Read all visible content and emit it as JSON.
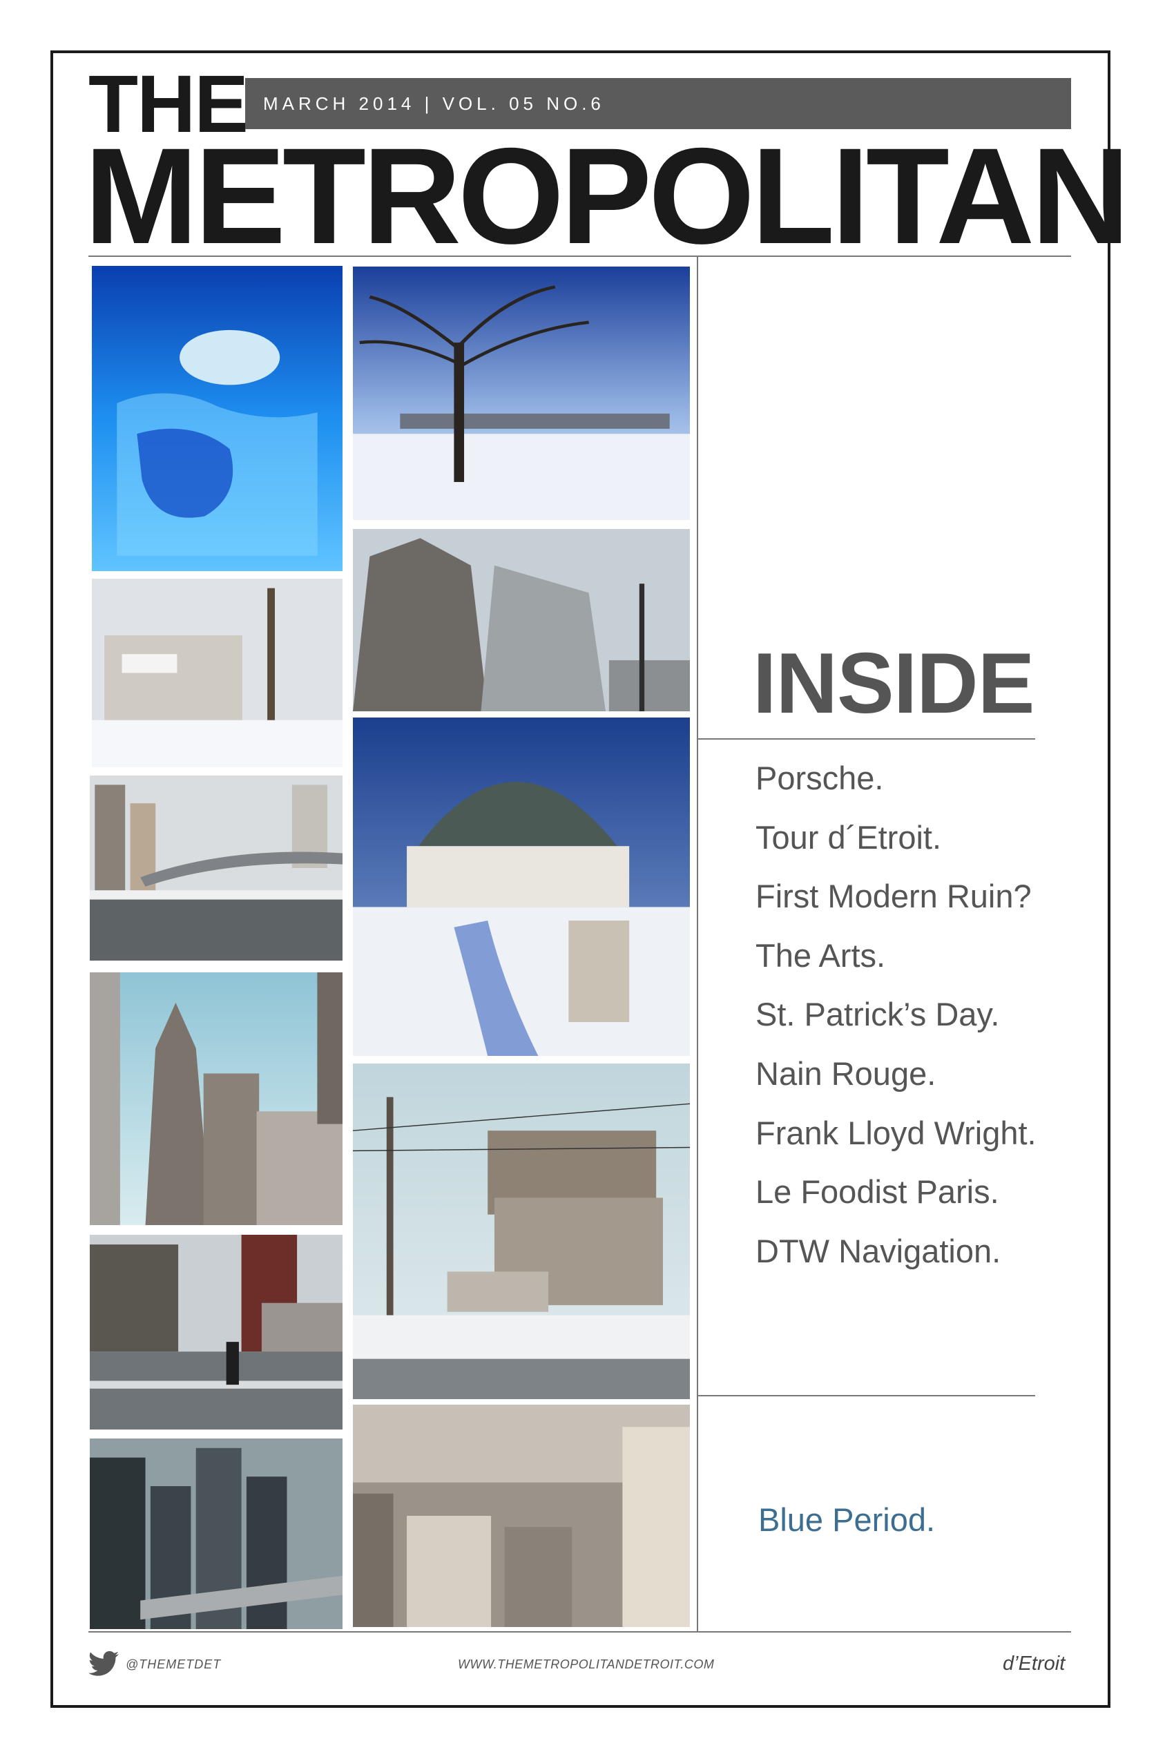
{
  "masthead": {
    "title_small": "THE",
    "title_large": "METROPOLITAN",
    "issue": "MARCH 2014 | VOL. 05 NO.6"
  },
  "photos": [
    {
      "name": "photo-polar-bear-underwater"
    },
    {
      "name": "photo-winter-tree-skyline"
    },
    {
      "name": "photo-snowy-warehouse"
    },
    {
      "name": "photo-grid-building"
    },
    {
      "name": "photo-people-mover-street"
    },
    {
      "name": "photo-conservatory-dome"
    },
    {
      "name": "photo-penobscot-tower"
    },
    {
      "name": "photo-michigan-central-station"
    },
    {
      "name": "photo-pedestrian-crossing"
    },
    {
      "name": "photo-renaissance-center"
    },
    {
      "name": "photo-downtown-aerial"
    }
  ],
  "inside": {
    "heading": "INSIDE",
    "items": [
      "Porsche.",
      "Tour d´Etroit.",
      "First Modern Ruin?",
      "The Arts.",
      "St. Patrick’s Day.",
      "Nain Rouge.",
      "Frank Lloyd Wright.",
      "Le Foodist Paris.",
      "DTW Navigation."
    ],
    "feature": "Blue Period."
  },
  "footer": {
    "handle": "@THEMETDET",
    "url": "WWW.THEMETROPOLITANDETROIT.COM",
    "brand": "d’Etroit"
  },
  "colors": {
    "accent_blue": "#3d6e92",
    "dateline_bg": "#5b5b5b",
    "text_gray": "#555555"
  }
}
